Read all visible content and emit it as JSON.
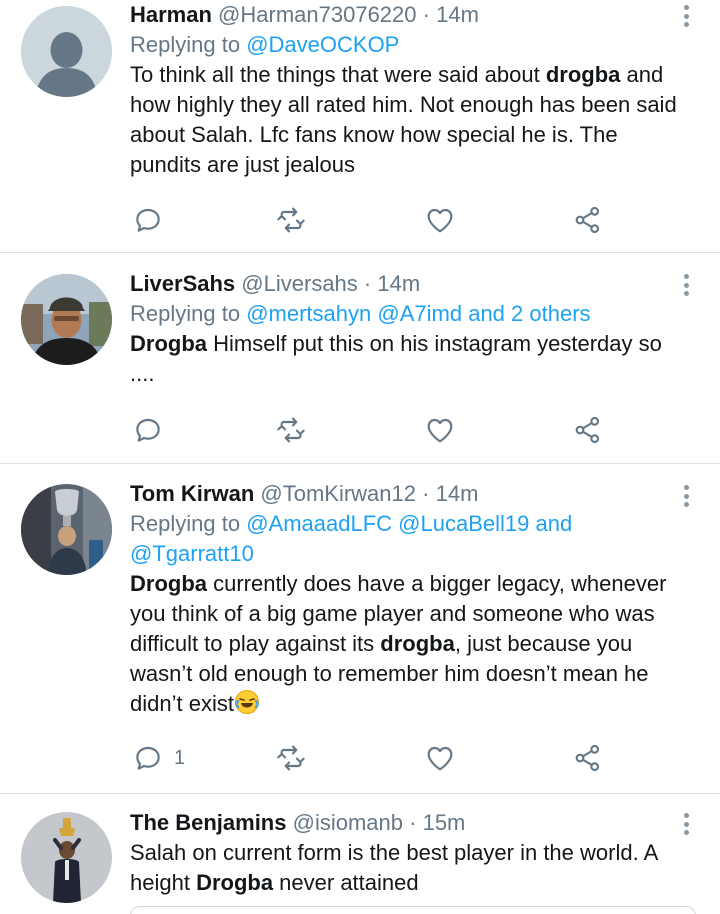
{
  "tweets": [
    {
      "name": "Harman",
      "handle": "@Harman73076220",
      "dot": "·",
      "time": "14m",
      "replying_label": "Replying to",
      "replying_to": [
        "@DaveOCKOP"
      ],
      "replying_others": "",
      "text_parts": [
        {
          "t": "To think all the things that were said about ",
          "b": false
        },
        {
          "t": "drogba",
          "b": true
        },
        {
          "t": " and how highly they all rated him. Not enough has been said about Salah. Lfc fans know how special he is. The pundits are just jealous",
          "b": false
        }
      ],
      "reply_count": "",
      "avatar": "default-avatar"
    },
    {
      "name": "LiverSahs",
      "handle": "@Liversahs",
      "dot": "·",
      "time": "14m",
      "replying_label": "Replying to",
      "replying_to": [
        "@mertsahyn",
        "@A7imd"
      ],
      "replying_others": "and 2 others",
      "text_parts": [
        {
          "t": "Drogba",
          "b": true
        },
        {
          "t": " Himself put this on his instagram yesterday so ....",
          "b": false
        }
      ],
      "reply_count": "",
      "avatar": "photo-avatar-cap"
    },
    {
      "name": "Tom Kirwan",
      "handle": "@TomKirwan12",
      "dot": "·",
      "time": "14m",
      "replying_label": "Replying to",
      "replying_to": [
        "@AmaaadLFC",
        "@LucaBell19",
        "and",
        "@Tgarratt10"
      ],
      "replying_others": "",
      "text_parts": [
        {
          "t": "Drogba",
          "b": true
        },
        {
          "t": " currently does have a bigger legacy, whenever you think of a big game player and someone who was difficult to play against its ",
          "b": false
        },
        {
          "t": "drogba",
          "b": true
        },
        {
          "t": ", just because you wasn’t old enough to remember him doesn’t mean he didn’t exist",
          "b": false
        }
      ],
      "emoji": "face-with-tears-of-joy",
      "reply_count": "1",
      "avatar": "photo-avatar-trophy"
    },
    {
      "name": "The Benjamins",
      "handle": "@isiomanb",
      "dot": "·",
      "time": "15m",
      "replying_label": "",
      "replying_to": [],
      "replying_others": "",
      "text_parts": [
        {
          "t": "Salah on current form is the best player in the world. A height ",
          "b": false
        },
        {
          "t": "Drogba",
          "b": true
        },
        {
          "t": " never attained",
          "b": false
        }
      ],
      "reply_count": "",
      "avatar": "photo-avatar-figure"
    }
  ],
  "colors": {
    "link": "#1da1f2",
    "secondary": "#657786",
    "divider": "#dfe3e6",
    "icon": "#657786"
  },
  "icons": [
    "reply-icon",
    "retweet-icon",
    "like-icon",
    "share-icon",
    "more-icon"
  ]
}
